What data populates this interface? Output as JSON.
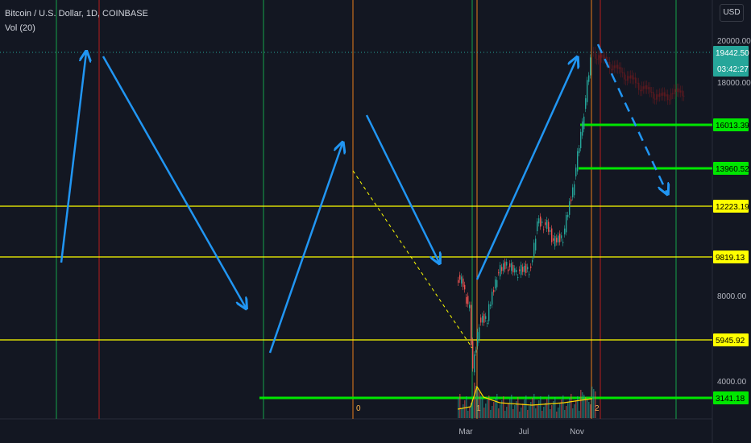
{
  "header": {
    "symbol_line": "Bitcoin / U.S. Dollar, 1D, COINBASE",
    "indicator": "Vol (20)"
  },
  "currency_button": "USD",
  "chart_data": {
    "type": "candlestick",
    "title": "Bitcoin / U.S. Dollar, 1D, COINBASE",
    "indicator": "Vol (20)",
    "price_axis_ticks": [
      "20000.00",
      "18000.00",
      "8000.00",
      "4000.00"
    ],
    "time_axis_ticks": [
      "Mar",
      "Jul",
      "Nov"
    ],
    "current_price": "19442.50",
    "countdown": "03:42:27",
    "price_levels": [
      {
        "label": "16013.39",
        "value": 16013.39,
        "color": "#00e600"
      },
      {
        "label": "13960.52",
        "value": 13960.52,
        "color": "#00e600"
      },
      {
        "label": "12223.19",
        "value": 12223.19,
        "color": "#ffff00"
      },
      {
        "label": "9819.13",
        "value": 9819.13,
        "color": "#ffff00"
      },
      {
        "label": "5945.92",
        "value": 5945.92,
        "color": "#ffff00"
      },
      {
        "label": "3141.18",
        "value": 3141.18,
        "color": "#00e600"
      }
    ],
    "cycle_markers": [
      "0",
      "1",
      "2"
    ],
    "vertical_lines": [
      {
        "color": "#16a34a"
      },
      {
        "color": "#b91c1c"
      },
      {
        "color": "#16a34a"
      },
      {
        "color": "#ea7c1a"
      },
      {
        "color": "#16a34a"
      },
      {
        "color": "#ea7c1a"
      },
      {
        "color": "#ea7c1a"
      },
      {
        "color": "#b91c1c"
      },
      {
        "color": "#16a34a"
      }
    ],
    "price_series_approx": [
      [
        8500,
        9000
      ],
      [
        7300,
        8500
      ],
      [
        4500,
        7300
      ],
      [
        6800,
        4500
      ],
      [
        7000,
        6800
      ],
      [
        9000,
        7000
      ],
      [
        9500,
        9000
      ],
      [
        9100,
        9500
      ],
      [
        9300,
        9100
      ],
      [
        11500,
        9300
      ],
      [
        11300,
        11500
      ],
      [
        10500,
        11300
      ],
      [
        10800,
        10500
      ],
      [
        13000,
        10800
      ],
      [
        15500,
        13000
      ],
      [
        19000,
        15500
      ],
      [
        19440,
        19000
      ]
    ],
    "colors": {
      "arrows": "#2196f3",
      "up": "#26a69a",
      "down": "#ef5350",
      "volume_ma": "#ffd600"
    }
  }
}
